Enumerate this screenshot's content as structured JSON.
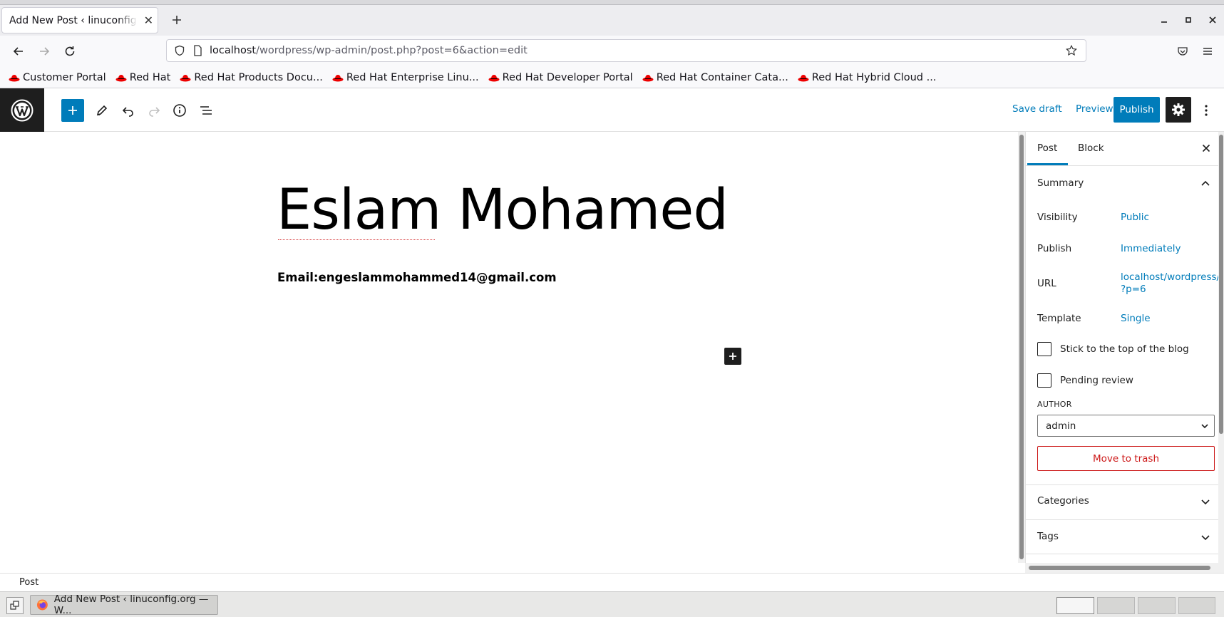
{
  "browser": {
    "tab_title": "Add New Post ‹ linuconfig.org — WordPress",
    "url_host": "localhost",
    "url_path": "/wordpress/wp-admin/post.php?post=6&action=edit",
    "bookmarks": [
      "Customer Portal",
      "Red Hat",
      "Red Hat Products Docu...",
      "Red Hat Enterprise Linu...",
      "Red Hat Developer Portal",
      "Red Hat Container Cata...",
      "Red Hat Hybrid Cloud ..."
    ]
  },
  "toolbar": {
    "save_draft": "Save draft",
    "preview": "Preview",
    "publish": "Publish"
  },
  "post": {
    "title": "Eslam Mohamed",
    "paragraph": "Email:engeslammohammed14@gmail.com"
  },
  "sidebar": {
    "tabs": {
      "post": "Post",
      "block": "Block"
    },
    "summary": "Summary",
    "visibility_label": "Visibility",
    "visibility_value": "Public",
    "publish_label": "Publish",
    "publish_value": "Immediately",
    "url_label": "URL",
    "url_value_line1": "localhost/wordpress/",
    "url_value_line2": "?p=6",
    "template_label": "Template",
    "template_value": "Single",
    "sticky_label": "Stick to the top of the blog",
    "pending_label": "Pending review",
    "author_label": "AUTHOR",
    "author_value": "admin",
    "trash": "Move to trash",
    "categories": "Categories",
    "tags": "Tags"
  },
  "footer": {
    "breadcrumb": "Post"
  },
  "taskbar": {
    "item": "Add New Post ‹ linuconfig.org — W..."
  },
  "colors": {
    "accent": "#007cba",
    "danger": "#cc1818",
    "redhat": "#ee0000"
  }
}
